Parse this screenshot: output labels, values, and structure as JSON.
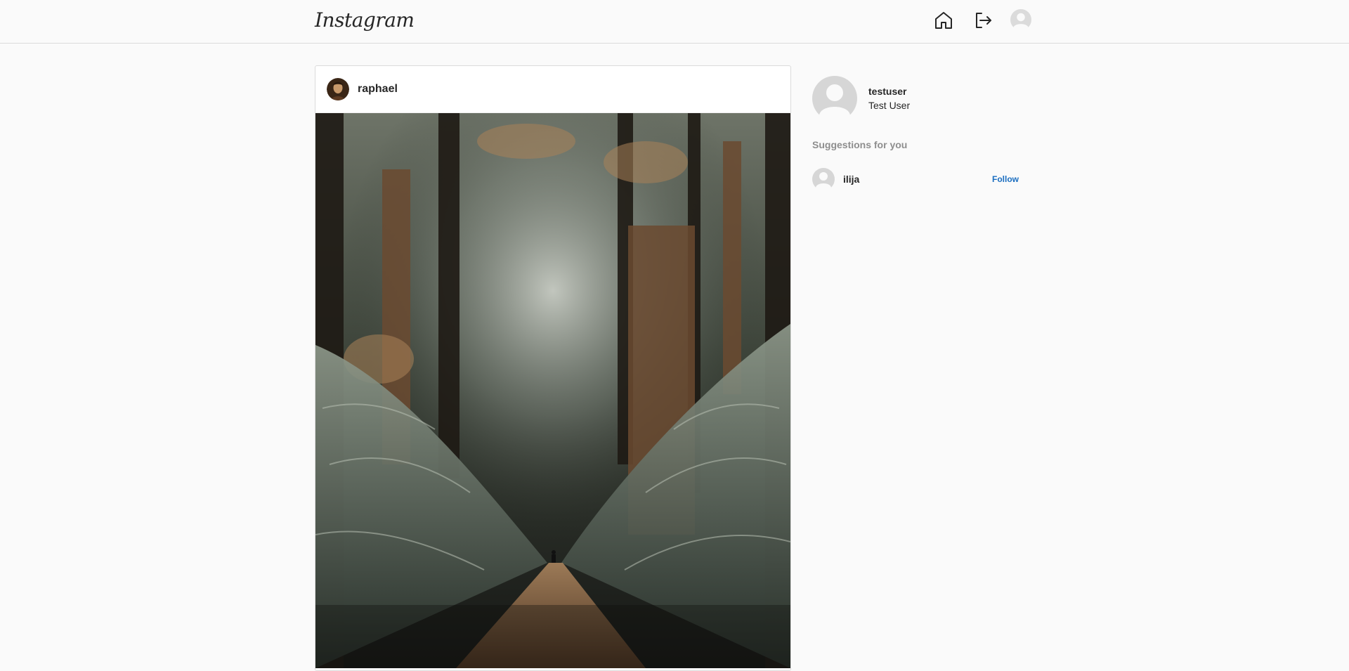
{
  "header": {
    "logo": "Instagram",
    "icons": [
      "home-icon",
      "logout-icon",
      "avatar"
    ]
  },
  "post": {
    "username": "raphael",
    "image": "forest-path-photo"
  },
  "sidebar": {
    "user": {
      "username": "testuser",
      "full_name": "Test User"
    },
    "suggestions_title": "Suggestions for you",
    "suggestions": [
      {
        "username": "ilija",
        "action": "Follow"
      }
    ]
  },
  "colors": {
    "background": "#fafafa",
    "border": "#dbdbdb",
    "text": "#262626",
    "muted": "#8e8e8e",
    "link": "#1b6ec0"
  }
}
